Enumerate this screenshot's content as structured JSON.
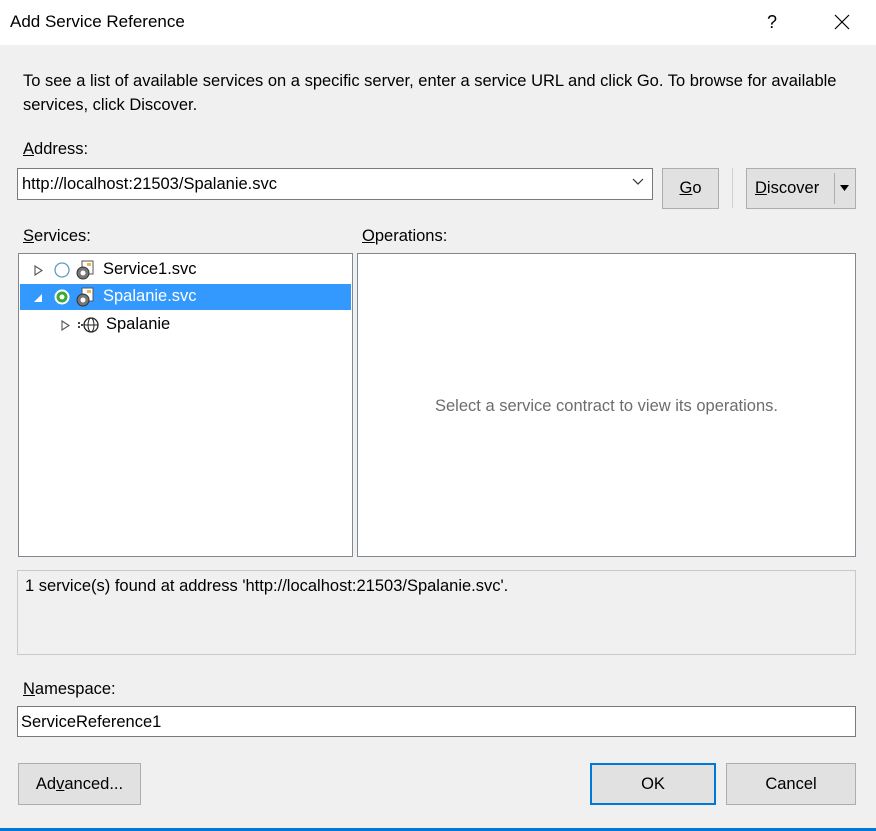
{
  "window": {
    "title": "Add Service Reference",
    "help_label": "?"
  },
  "instructions": "To see a list of available services on a specific server, enter a service URL and click Go. To browse for available services, click Discover.",
  "address": {
    "label_accel": "A",
    "label_rest": "ddress:",
    "value": "http://localhost:21503/Spalanie.svc"
  },
  "buttons": {
    "go_accel": "G",
    "go_rest": "o",
    "discover_accel": "D",
    "discover_rest": "iscover",
    "advanced_pre": "Ad",
    "advanced_accel": "v",
    "advanced_post": "anced...",
    "ok": "OK",
    "cancel": "Cancel"
  },
  "services": {
    "label_accel": "S",
    "label_rest": "ervices:",
    "items": [
      {
        "label": "Service1.svc",
        "expanded": false,
        "selected": false
      },
      {
        "label": "Spalanie.svc",
        "expanded": true,
        "selected": true
      },
      {
        "label": "Spalanie",
        "expanded": false,
        "selected": false,
        "child": true
      }
    ]
  },
  "operations": {
    "label_accel": "O",
    "label_rest": "perations:",
    "placeholder": "Select a service contract to view its operations."
  },
  "status_message": "1 service(s) found at address 'http://localhost:21503/Spalanie.svc'.",
  "namespace": {
    "label_accel": "N",
    "label_rest": "amespace:",
    "value": "ServiceReference1"
  },
  "colors": {
    "accent": "#0078d7",
    "selection": "#3399ff"
  }
}
